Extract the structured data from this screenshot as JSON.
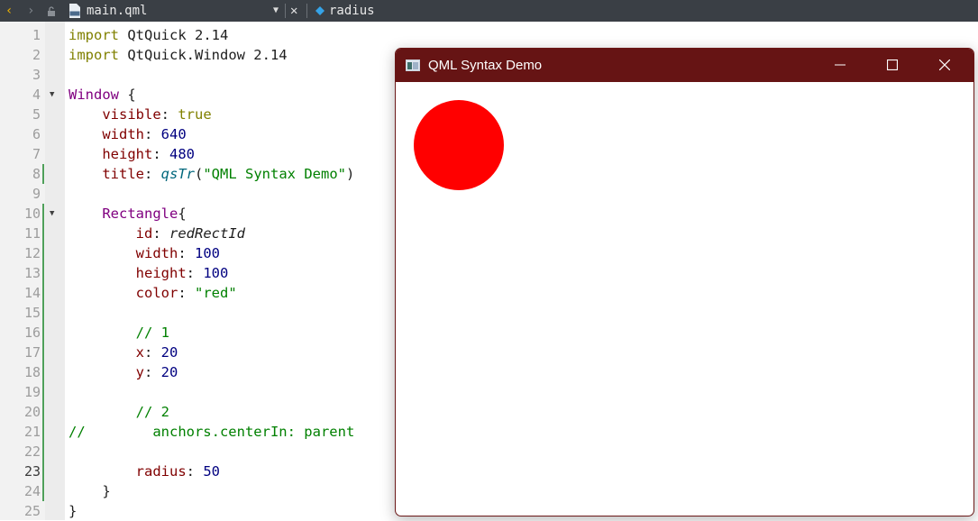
{
  "toolbar": {
    "back_glyph": "‹",
    "forward_glyph": "›",
    "file_name": "main.qml",
    "dropdown_glyph": "▼",
    "close_glyph": "✕",
    "symbol_name": "radius"
  },
  "editor": {
    "current_line": 23,
    "lines": [
      {
        "n": "1"
      },
      {
        "n": "2"
      },
      {
        "n": "3"
      },
      {
        "n": "4"
      },
      {
        "n": "5"
      },
      {
        "n": "6"
      },
      {
        "n": "7"
      },
      {
        "n": "8"
      },
      {
        "n": "9"
      },
      {
        "n": "10"
      },
      {
        "n": "11"
      },
      {
        "n": "12"
      },
      {
        "n": "13"
      },
      {
        "n": "14"
      },
      {
        "n": "15"
      },
      {
        "n": "16"
      },
      {
        "n": "17"
      },
      {
        "n": "18"
      },
      {
        "n": "19"
      },
      {
        "n": "20"
      },
      {
        "n": "21"
      },
      {
        "n": "22"
      },
      {
        "n": "23"
      },
      {
        "n": "24"
      },
      {
        "n": "25"
      }
    ],
    "code": [
      [
        {
          "c": "kw",
          "t": "import"
        },
        {
          "c": "",
          "t": " QtQuick 2.14"
        }
      ],
      [
        {
          "c": "kw",
          "t": "import"
        },
        {
          "c": "",
          "t": " QtQuick.Window 2.14"
        }
      ],
      [],
      [
        {
          "c": "ty",
          "t": "Window"
        },
        {
          "c": "",
          "t": " {"
        }
      ],
      [
        {
          "c": "",
          "t": "    "
        },
        {
          "c": "pr",
          "t": "visible"
        },
        {
          "c": "",
          "t": ": "
        },
        {
          "c": "kw",
          "t": "true"
        }
      ],
      [
        {
          "c": "",
          "t": "    "
        },
        {
          "c": "pr",
          "t": "width"
        },
        {
          "c": "",
          "t": ": "
        },
        {
          "c": "num",
          "t": "640"
        }
      ],
      [
        {
          "c": "",
          "t": "    "
        },
        {
          "c": "pr",
          "t": "height"
        },
        {
          "c": "",
          "t": ": "
        },
        {
          "c": "num",
          "t": "480"
        }
      ],
      [
        {
          "c": "",
          "t": "    "
        },
        {
          "c": "pr",
          "t": "title"
        },
        {
          "c": "",
          "t": ": "
        },
        {
          "c": "fn",
          "t": "qsTr"
        },
        {
          "c": "",
          "t": "("
        },
        {
          "c": "str",
          "t": "\"QML Syntax Demo\""
        },
        {
          "c": "",
          "t": ")"
        }
      ],
      [],
      [
        {
          "c": "",
          "t": "    "
        },
        {
          "c": "ty",
          "t": "Rectangle"
        },
        {
          "c": "",
          "t": "{"
        }
      ],
      [
        {
          "c": "",
          "t": "        "
        },
        {
          "c": "pr",
          "t": "id"
        },
        {
          "c": "",
          "t": ": "
        },
        {
          "c": "id",
          "t": "redRectId"
        }
      ],
      [
        {
          "c": "",
          "t": "        "
        },
        {
          "c": "pr",
          "t": "width"
        },
        {
          "c": "",
          "t": ": "
        },
        {
          "c": "num",
          "t": "100"
        }
      ],
      [
        {
          "c": "",
          "t": "        "
        },
        {
          "c": "pr",
          "t": "height"
        },
        {
          "c": "",
          "t": ": "
        },
        {
          "c": "num",
          "t": "100"
        }
      ],
      [
        {
          "c": "",
          "t": "        "
        },
        {
          "c": "pr",
          "t": "color"
        },
        {
          "c": "",
          "t": ": "
        },
        {
          "c": "str",
          "t": "\"red\""
        }
      ],
      [],
      [
        {
          "c": "",
          "t": "        "
        },
        {
          "c": "cm",
          "t": "// 1"
        }
      ],
      [
        {
          "c": "",
          "t": "        "
        },
        {
          "c": "pr",
          "t": "x"
        },
        {
          "c": "",
          "t": ": "
        },
        {
          "c": "num",
          "t": "20"
        }
      ],
      [
        {
          "c": "",
          "t": "        "
        },
        {
          "c": "pr",
          "t": "y"
        },
        {
          "c": "",
          "t": ": "
        },
        {
          "c": "num",
          "t": "20"
        }
      ],
      [],
      [
        {
          "c": "",
          "t": "        "
        },
        {
          "c": "cm",
          "t": "// 2"
        }
      ],
      [
        {
          "c": "cm",
          "t": "//        anchors.centerIn: parent"
        }
      ],
      [],
      [
        {
          "c": "",
          "t": "        "
        },
        {
          "c": "pr",
          "t": "radius"
        },
        {
          "c": "",
          "t": ": "
        },
        {
          "c": "num",
          "t": "50"
        }
      ],
      [
        {
          "c": "",
          "t": "    }"
        }
      ],
      [
        {
          "c": "",
          "t": "}"
        }
      ]
    ]
  },
  "app_window": {
    "title": "QML Syntax Demo",
    "minimize_label": "minimize",
    "maximize_label": "maximize",
    "close_label": "close",
    "titlebar_color": "#661414",
    "circle_color": "#ff0000"
  }
}
